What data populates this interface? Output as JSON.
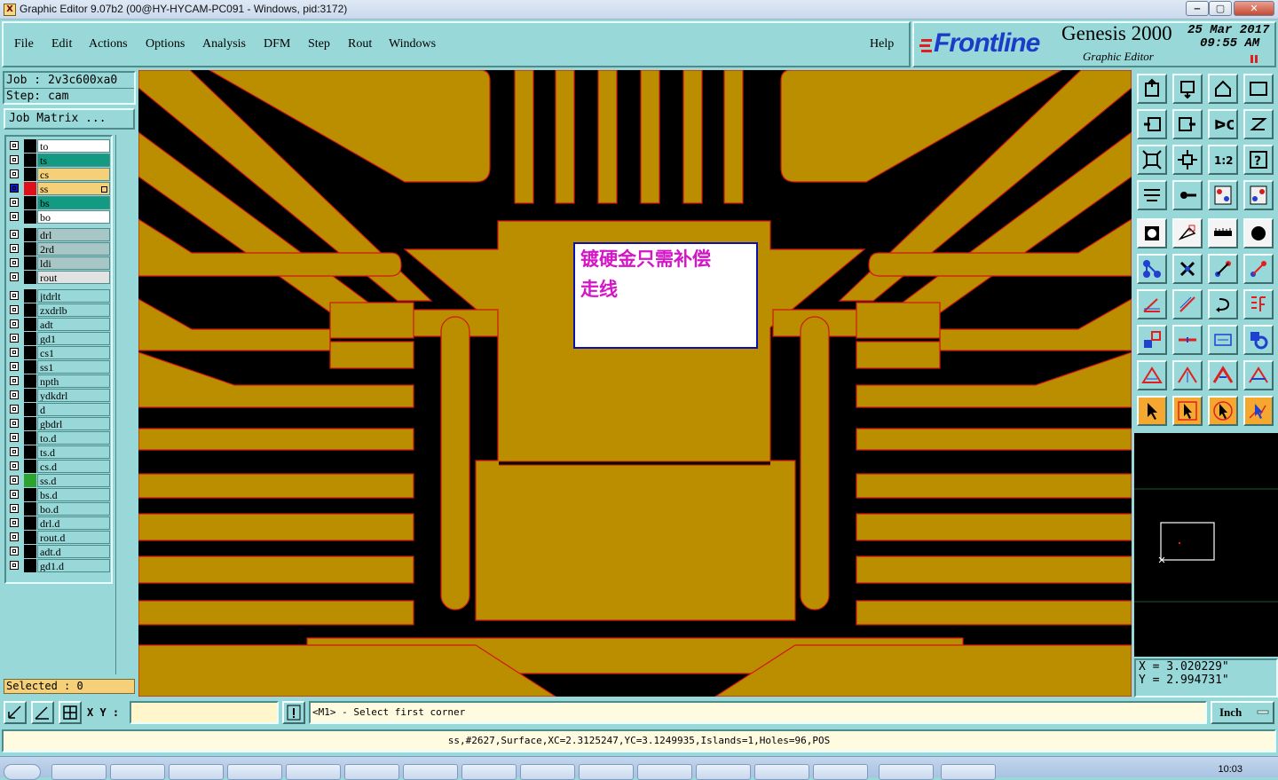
{
  "window": {
    "title": "Graphic Editor 9.07b2 (00@HY-HYCAM-PC091 - Windows, pid:3172)",
    "controls": {
      "minimize": "‒",
      "maximize": "▢",
      "close": "✕"
    }
  },
  "menu": [
    "File",
    "Edit",
    "Actions",
    "Options",
    "Analysis",
    "DFM",
    "Step",
    "Rout",
    "Windows"
  ],
  "help_label": "Help",
  "brand": {
    "logo": "Frontline",
    "product": "Genesis 2000",
    "subtitle": "Graphic Editor",
    "date": "25 Mar 2017",
    "time": "09:55 AM"
  },
  "job": {
    "job_line": "Job : 2v3c600xa0",
    "step_line": "Step: cam",
    "matrix_button": "Job Matrix ..."
  },
  "layers": [
    {
      "name": "to",
      "color": "#ffffff"
    },
    {
      "name": "ts",
      "color": "#129a82"
    },
    {
      "name": "cs",
      "color": "#f5d078"
    },
    {
      "name": "ss",
      "color": "#f5d078",
      "active": true,
      "swatch": "#e0101a"
    },
    {
      "name": "bs",
      "color": "#129a82"
    },
    {
      "name": "bo",
      "color": "#ffffff"
    },
    {
      "name": "drl",
      "color": "#a8c6c6"
    },
    {
      "name": "2rd",
      "color": "#a8c6c6"
    },
    {
      "name": "ldi",
      "color": "#a8c6c6"
    },
    {
      "name": "rout",
      "color": "#e2e2e2"
    },
    {
      "name": "jtdrlt",
      "color": "#98d8d8"
    },
    {
      "name": "zxdrlb",
      "color": "#98d8d8"
    },
    {
      "name": "adt",
      "color": "#98d8d8"
    },
    {
      "name": "gd1",
      "color": "#98d8d8"
    },
    {
      "name": "cs1",
      "color": "#98d8d8"
    },
    {
      "name": "ss1",
      "color": "#98d8d8"
    },
    {
      "name": "npth",
      "color": "#98d8d8"
    },
    {
      "name": "ydkdrl",
      "color": "#98d8d8"
    },
    {
      "name": "d",
      "color": "#98d8d8"
    },
    {
      "name": "gbdrl",
      "color": "#98d8d8"
    },
    {
      "name": "to.d",
      "color": "#98d8d8"
    },
    {
      "name": "ts.d",
      "color": "#98d8d8"
    },
    {
      "name": "cs.d",
      "color": "#98d8d8"
    },
    {
      "name": "ss.d",
      "color": "#98d8d8",
      "swatch": "#2fa32f"
    },
    {
      "name": "bs.d",
      "color": "#98d8d8"
    },
    {
      "name": "bo.d",
      "color": "#98d8d8"
    },
    {
      "name": "drl.d",
      "color": "#98d8d8"
    },
    {
      "name": "rout.d",
      "color": "#98d8d8"
    },
    {
      "name": "adt.d",
      "color": "#98d8d8"
    },
    {
      "name": "gd1.d",
      "color": "#98d8d8"
    }
  ],
  "selected_text": "Selected : 0",
  "annotation": {
    "line1": "镀硬金只需补偿",
    "line2": "走线"
  },
  "colors": {
    "copper": "#bb8e00",
    "trace_outline": "#d01818",
    "annotation_text": "#d515c8",
    "annotation_border": "#0b10b4",
    "panel_bg": "#98d8d8"
  },
  "coords": {
    "x": "X = 3.020229\"",
    "y": "Y = 2.994731\""
  },
  "xy_label": "X Y :",
  "xy_input_value": "",
  "prompt": "<M1> - Select first corner",
  "units": "Inch",
  "status_line": "ss,#2627,Surface,XC=2.3125247,YC=3.1249935,Islands=1,Holes=96,POS",
  "clock": "10:03"
}
